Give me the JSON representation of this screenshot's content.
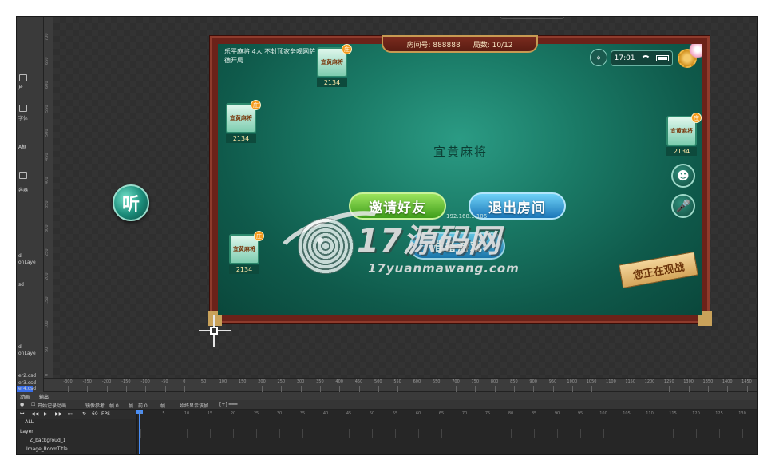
{
  "editor": {
    "left_panel": [
      {
        "label": "片"
      },
      {
        "label": "字体"
      },
      {
        "label": "A框"
      },
      {
        "label": "容器"
      },
      {
        "label": "d"
      },
      {
        "label": "onLaye"
      },
      {
        "label": "sd"
      },
      {
        "label": "d"
      },
      {
        "label": "onLaye"
      },
      {
        "label": "er2.csd"
      },
      {
        "label": "er3.csd"
      },
      {
        "label": "er4.csd"
      },
      {
        "label": "sd"
      },
      {
        "label": "onLay"
      }
    ],
    "ruler_v": [
      "700",
      "650",
      "600",
      "550",
      "500",
      "450",
      "400",
      "350",
      "300",
      "250",
      "200",
      "150",
      "100",
      "50",
      "0"
    ],
    "ruler_h": [
      "-300",
      "-250",
      "-200",
      "-150",
      "-100",
      "-50",
      "0",
      "50",
      "100",
      "150",
      "200",
      "250",
      "300",
      "350",
      "400",
      "450",
      "500",
      "550",
      "600",
      "650",
      "700",
      "750",
      "800",
      "850",
      "900",
      "950",
      "1000",
      "1050",
      "1100",
      "1150",
      "1200",
      "1250",
      "1300",
      "1350",
      "1400",
      "1450"
    ],
    "timeline": {
      "tabs": [
        "动画",
        "输出"
      ],
      "start_record": "开始记录动画",
      "mirror_ref": "镜像参考",
      "frame_a": "帧 0",
      "frame_b": "帧",
      "frame_c": "前 0",
      "frame_d": "帧",
      "auto_show": "始终显示该帧",
      "fps_value": "60",
      "fps_label": "FPS",
      "filter": "-- ALL --",
      "frames": [
        "0",
        "5",
        "10",
        "15",
        "20",
        "25",
        "30",
        "35",
        "40",
        "45",
        "50",
        "55",
        "60",
        "65",
        "70",
        "75",
        "80",
        "85",
        "90",
        "95",
        "100",
        "105",
        "110",
        "115",
        "120",
        "125",
        "130"
      ],
      "layers": [
        "Layer",
        "Z_backgroud_1",
        "Image_RoomTitle"
      ]
    }
  },
  "game": {
    "listen_label": "听",
    "room_label": "房间号: 888888",
    "rounds_label": "局数: 10/12",
    "rules_text": "乐平麻将 4人 不封顶家务喝网萨德开局",
    "time": "17:01",
    "title": "宜黄麻将",
    "players": [
      {
        "name": "宜黄麻将",
        "score": "2134",
        "dealer": "庄"
      },
      {
        "name": "宜黄麻将",
        "score": "2134",
        "dealer": "庄"
      },
      {
        "name": "宜黄麻将",
        "score": "2134",
        "dealer": "庄"
      },
      {
        "name": "宜黄麻将",
        "score": "2134",
        "dealer": "庄"
      }
    ],
    "invite_btn": "邀请好友",
    "exit_btn": "退出房间",
    "ready_btn": "准备游戏",
    "ip_text": "192.168.1.106",
    "spectating": "您正在观战",
    "emoji_icon": "☻",
    "mic_icon": "🎤",
    "loc_icon": "⌖"
  },
  "watermark": {
    "main": "17源码网",
    "sub": "17yuanmawang.com"
  },
  "colors": {
    "felt": "#1a7a66",
    "frame_wood": "#6b2219",
    "accent_blue": "#4a8ef5"
  }
}
